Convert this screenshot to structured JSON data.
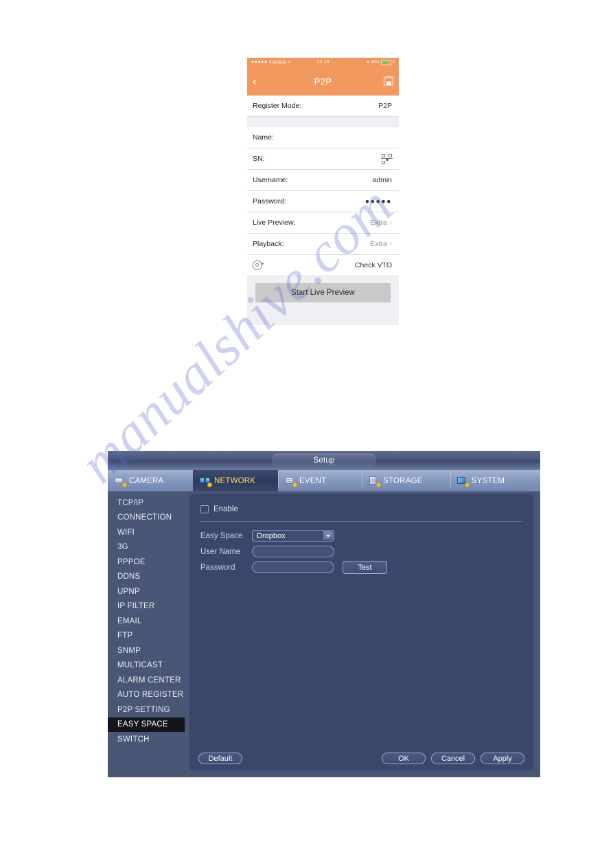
{
  "watermark": {
    "text": "manualshive.com"
  },
  "phone": {
    "status_bar": {
      "signal_dots": "●●●●●",
      "carrier": "中国移动",
      "wifi_icon": "wifi-icon",
      "time": "12:16",
      "bluetooth_icon": "bluetooth-icon",
      "battery_percent": "46%",
      "battery_icon": "battery-icon",
      "trailing": "4"
    },
    "nav": {
      "back_icon": "chevron-left-icon",
      "title": "P2P",
      "save_icon": "save-icon"
    },
    "rows": [
      {
        "label": "Register Mode:",
        "value": "P2P",
        "type": "text"
      },
      {
        "label": "Name:",
        "value": "",
        "type": "text"
      },
      {
        "label": "SN:",
        "value": "",
        "type": "qr"
      },
      {
        "label": "Username:",
        "value": "admin",
        "type": "text"
      },
      {
        "label": "Password:",
        "value": "●●●●●",
        "type": "password"
      },
      {
        "label": "Live Preview:",
        "value": "Extra",
        "type": "chevron"
      },
      {
        "label": "Playback:",
        "value": "Extra",
        "type": "chevron"
      },
      {
        "label": "",
        "value": "Check VTO",
        "type": "vto"
      }
    ],
    "action_button": "Start Live Preview"
  },
  "nvr": {
    "title": "Setup",
    "tabs": [
      {
        "label": "CAMERA",
        "icon": "camera-icon",
        "active": false
      },
      {
        "label": "NETWORK",
        "icon": "network-icon",
        "active": true
      },
      {
        "label": "EVENT",
        "icon": "event-icon",
        "active": false
      },
      {
        "label": "STORAGE",
        "icon": "storage-icon",
        "active": false
      },
      {
        "label": "SYSTEM",
        "icon": "system-icon",
        "active": false
      }
    ],
    "sidebar": [
      {
        "label": "TCP/IP",
        "active": false
      },
      {
        "label": "CONNECTION",
        "active": false
      },
      {
        "label": "WIFI",
        "active": false
      },
      {
        "label": "3G",
        "active": false
      },
      {
        "label": "PPPOE",
        "active": false
      },
      {
        "label": "DDNS",
        "active": false
      },
      {
        "label": "UPNP",
        "active": false
      },
      {
        "label": "IP FILTER",
        "active": false
      },
      {
        "label": "EMAIL",
        "active": false
      },
      {
        "label": "FTP",
        "active": false
      },
      {
        "label": "SNMP",
        "active": false
      },
      {
        "label": "MULTICAST",
        "active": false
      },
      {
        "label": "ALARM CENTER",
        "active": false
      },
      {
        "label": "AUTO REGISTER",
        "active": false
      },
      {
        "label": "P2P SETTING",
        "active": false
      },
      {
        "label": "EASY SPACE",
        "active": true
      },
      {
        "label": "SWITCH",
        "active": false
      }
    ],
    "form": {
      "enable_label": "Enable",
      "enable_checked": false,
      "easy_space_label": "Easy Space",
      "easy_space_value": "Dropbox",
      "user_name_label": "User Name",
      "user_name_value": "",
      "password_label": "Password",
      "password_value": "",
      "test_button": "Test"
    },
    "buttons": {
      "default": "Default",
      "ok": "OK",
      "cancel": "Cancel",
      "apply": "Apply"
    },
    "colors": {
      "dialog_bg": "#4a5675",
      "content_bg": "#3a476b",
      "active_tab_text": "#ffe06b",
      "active_item_bg": "#14151c"
    }
  }
}
